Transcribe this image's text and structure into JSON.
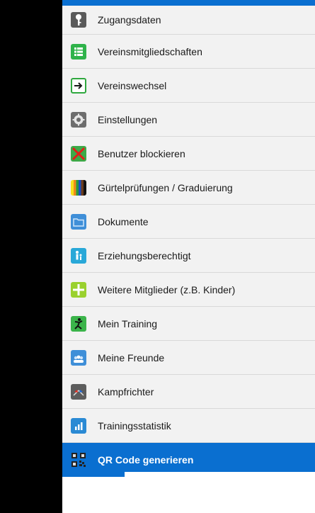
{
  "menu": {
    "items": [
      {
        "label": "Zugangsdaten",
        "icon": "key-icon"
      },
      {
        "label": "Vereinsmitgliedschaften",
        "icon": "membership-list-icon"
      },
      {
        "label": "Vereinswechsel",
        "icon": "arrow-right-box-icon"
      },
      {
        "label": "Einstellungen",
        "icon": "gear-icon"
      },
      {
        "label": "Benutzer blockieren",
        "icon": "block-user-icon"
      },
      {
        "label": "Gürtelprüfungen / Graduierung",
        "icon": "belt-colors-icon"
      },
      {
        "label": "Dokumente",
        "icon": "folder-icon"
      },
      {
        "label": "Erziehungsberechtigt",
        "icon": "guardian-icon"
      },
      {
        "label": "Weitere Mitglieder (z.B. Kinder)",
        "icon": "plus-icon"
      },
      {
        "label": "Mein Training",
        "icon": "training-figure-icon"
      },
      {
        "label": "Meine Freunde",
        "icon": "friends-icon"
      },
      {
        "label": "Kampfrichter",
        "icon": "referee-flags-icon"
      },
      {
        "label": "Trainingsstatistik",
        "icon": "bar-chart-icon"
      },
      {
        "label": "QR Code generieren",
        "icon": "qr-code-icon"
      }
    ],
    "active_index": 13
  },
  "colors": {
    "accent": "#0a6fd0",
    "item_bg": "#f2f2f2",
    "divider": "#d9d9d9"
  }
}
